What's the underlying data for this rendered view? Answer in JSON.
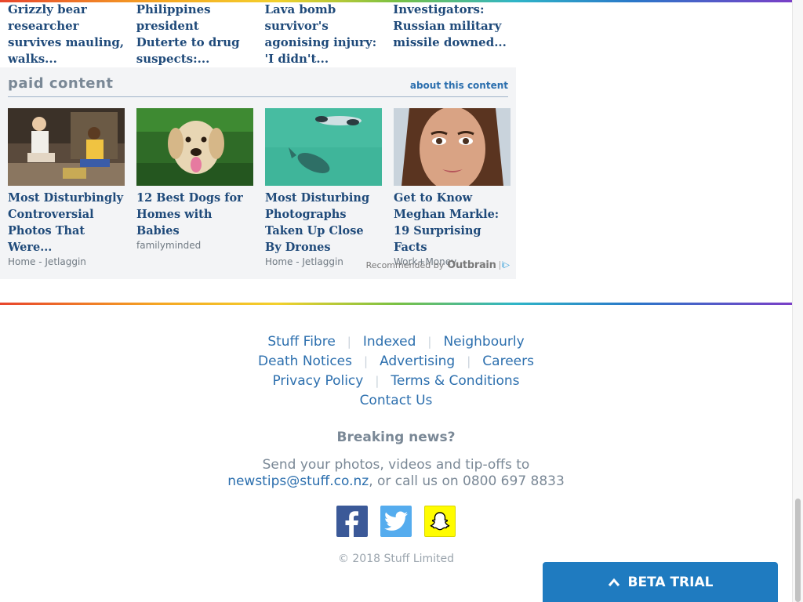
{
  "news": [
    {
      "title": "Grizzly bear researcher survives mauling, walks..."
    },
    {
      "title": "Philippines president Duterte to drug suspects:..."
    },
    {
      "title": "Lava bomb survivor's agonising injury: 'I didn't..."
    },
    {
      "title": "Investigators: Russian military missile downed..."
    }
  ],
  "paid": {
    "title": "paid content",
    "about": "about this content",
    "cards": [
      {
        "title": "Most Disturbingly Controversial Photos That Were...",
        "source": "Home - Jetlaggin"
      },
      {
        "title": "12 Best Dogs for Homes with Babies",
        "source": "familyminded"
      },
      {
        "title": "Most Disturbing Photographs Taken Up Close By Drones",
        "source": "Home - Jetlaggin"
      },
      {
        "title": "Get to Know Meghan Markle: 19 Surprising Facts",
        "source": "Work+Money"
      }
    ],
    "recommended": "Recommended by",
    "outbrain": "Outbrain",
    "info": "i▷"
  },
  "footer": {
    "links": [
      [
        "Stuff Fibre",
        "Indexed",
        "Neighbourly"
      ],
      [
        "Death Notices",
        "Advertising",
        "Careers"
      ],
      [
        "Privacy Policy",
        "Terms & Conditions"
      ],
      [
        "Contact Us"
      ]
    ],
    "separator": "|",
    "breaking": "Breaking news?",
    "tip_line1": "Send your photos, videos and tip-offs to",
    "tip_email": "newstips@stuff.co.nz",
    "tip_line2": ", or call us on 0800 697 8833",
    "copyright": "© 2018 Stuff Limited"
  },
  "social": [
    {
      "name": "facebook-icon",
      "color": "#3b5998"
    },
    {
      "name": "twitter-icon",
      "color": "#55acee"
    },
    {
      "name": "snapchat-icon",
      "color": "#fffc00"
    }
  ],
  "beta": {
    "label": "BETA TRIAL",
    "icon": "chevron-up-icon"
  }
}
